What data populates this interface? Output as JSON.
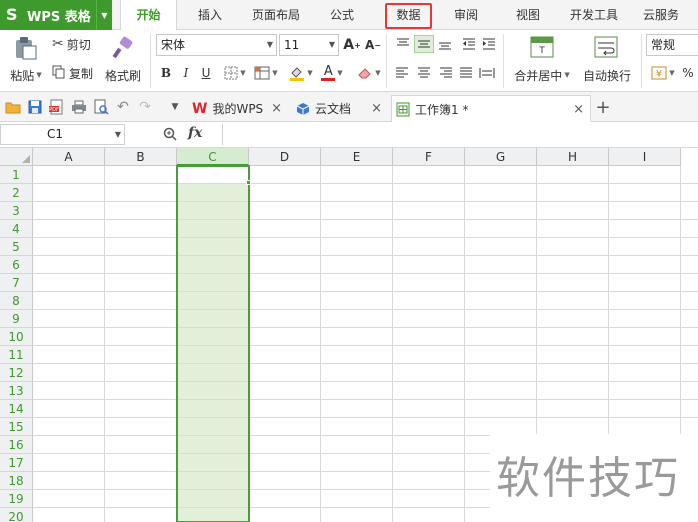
{
  "app": {
    "logo": "S",
    "title": "WPS 表格"
  },
  "menu": {
    "tabs": [
      {
        "label": "开始"
      },
      {
        "label": "插入"
      },
      {
        "label": "页面布局"
      },
      {
        "label": "公式"
      },
      {
        "label": "数据"
      },
      {
        "label": "审阅"
      },
      {
        "label": "视图"
      },
      {
        "label": "开发工具"
      },
      {
        "label": "云服务"
      }
    ],
    "active": "开始",
    "highlighted": "数据",
    "highlight_color": "#e23a3a"
  },
  "ribbon": {
    "paste": "粘贴",
    "cut": "剪切",
    "copy": "复制",
    "format_painter": "格式刷",
    "font_name": "宋体",
    "font_size": "11",
    "bold": "B",
    "italic": "I",
    "underline": "U",
    "font_color_letter": "A",
    "merge_center": "合并居中",
    "wrap_text": "自动换行",
    "number_format": "常规",
    "percent": "%"
  },
  "doc_tabs": [
    {
      "label": "我的WPS"
    },
    {
      "label": "云文档"
    },
    {
      "label": "工作簿1 *"
    }
  ],
  "formula_bar": {
    "name_box": "C1",
    "fx": "fx",
    "value": ""
  },
  "sheet": {
    "columns": [
      "A",
      "B",
      "C",
      "D",
      "E",
      "F",
      "G",
      "H",
      "I"
    ],
    "rows": [
      "1",
      "2",
      "3",
      "4",
      "5",
      "6",
      "7",
      "8",
      "9",
      "10",
      "11",
      "12",
      "13",
      "14",
      "15",
      "16",
      "17",
      "18",
      "19",
      "20"
    ],
    "selected_column": "C",
    "active_cell": "C1",
    "accent_color": "#3f9a2d"
  },
  "watermark": "软件技巧"
}
